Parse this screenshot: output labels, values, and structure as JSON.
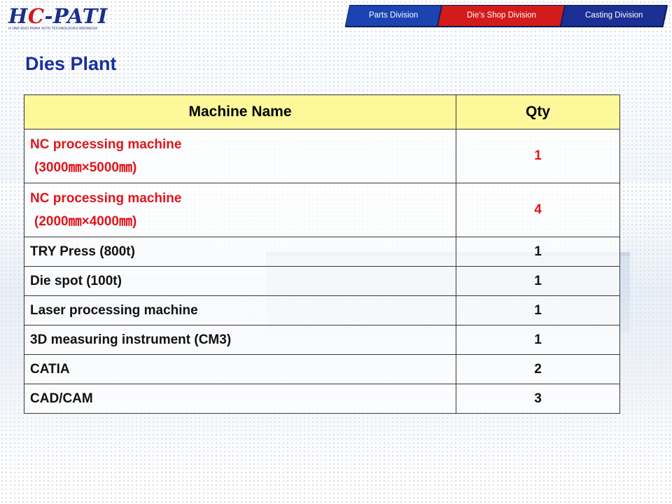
{
  "logo": {
    "part1": "H",
    "part2": "C",
    "part3": "-PATI",
    "tagline": "H-ONE KOGI PRIMA AUTO TECHNOLOGIES INDONESIA"
  },
  "tabs": [
    {
      "label": "Parts Division",
      "color": "#1b44b2"
    },
    {
      "label": "Die’s Shop Division",
      "color": "#d31b1b"
    },
    {
      "label": "Casting Division",
      "color": "#1b2f94"
    }
  ],
  "page_title": "Dies Plant",
  "table": {
    "headers": {
      "name": "Machine Name",
      "qty": "Qty"
    },
    "header_color": "#fdf99a",
    "highlight_color": "#e0141c",
    "rows": [
      {
        "name": "NC processing machine",
        "size": "(3000㎜×5000㎜)",
        "qty": "1"
      },
      {
        "name": "NC processing machine",
        "size": "(2000㎜×4000㎜)",
        "qty": "4"
      },
      {
        "name": "TRY Press (800t)",
        "qty": "1"
      },
      {
        "name": "Die spot (100t)",
        "qty": "1"
      },
      {
        "name": "Laser processing machine",
        "qty": "1"
      },
      {
        "name": "3D measuring instrument (CM3)",
        "qty": "1"
      },
      {
        "name": "CATIA",
        "qty": "2"
      },
      {
        "name": "CAD/CAM",
        "qty": "3"
      }
    ]
  }
}
